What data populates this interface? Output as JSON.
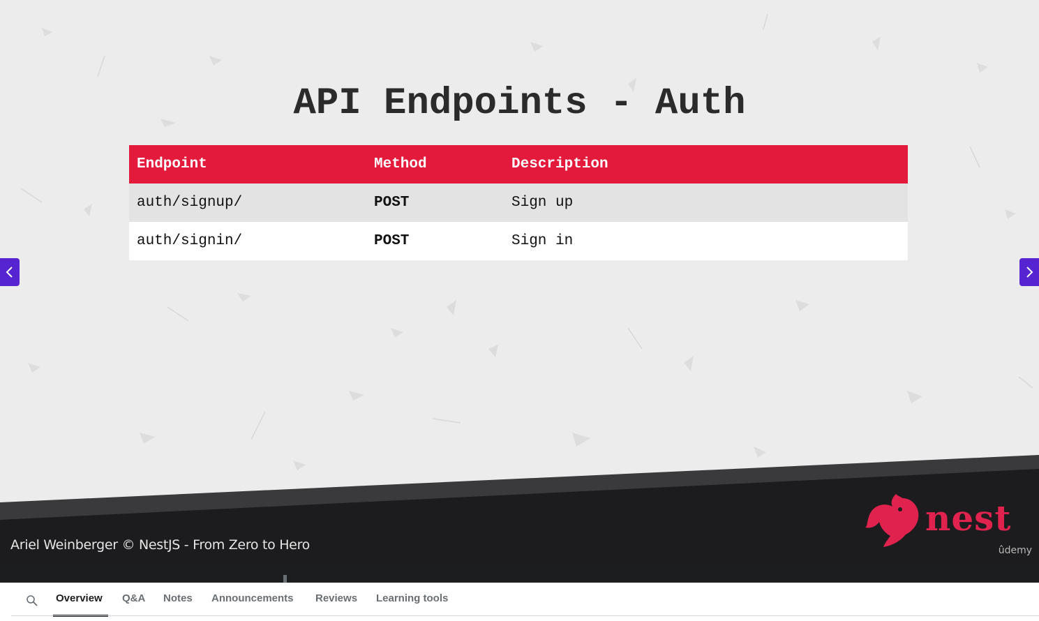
{
  "slide": {
    "title": "API Endpoints - Auth",
    "table": {
      "headers": [
        "Endpoint",
        "Method",
        "Description"
      ],
      "rows": [
        [
          "auth/signup/",
          "POST",
          "Sign up"
        ],
        [
          "auth/signin/",
          "POST",
          "Sign in"
        ]
      ]
    },
    "credit": "Ariel Weinberger © NestJS - From Zero to Hero",
    "logo_text": "nest",
    "brand": "ûdemy"
  },
  "nav": {
    "prev_icon": "chevron-left-icon",
    "next_icon": "chevron-right-icon"
  },
  "tabs": {
    "search_icon": "search-icon",
    "items": [
      "Overview",
      "Q&A",
      "Notes",
      "Announcements",
      "Reviews",
      "Learning tools"
    ],
    "active": "Overview"
  },
  "colors": {
    "table_header": "#e31a3b",
    "nav_arrow": "#5624d0",
    "nest_red": "#e0234e",
    "player_dark": "#1c1d1f"
  }
}
